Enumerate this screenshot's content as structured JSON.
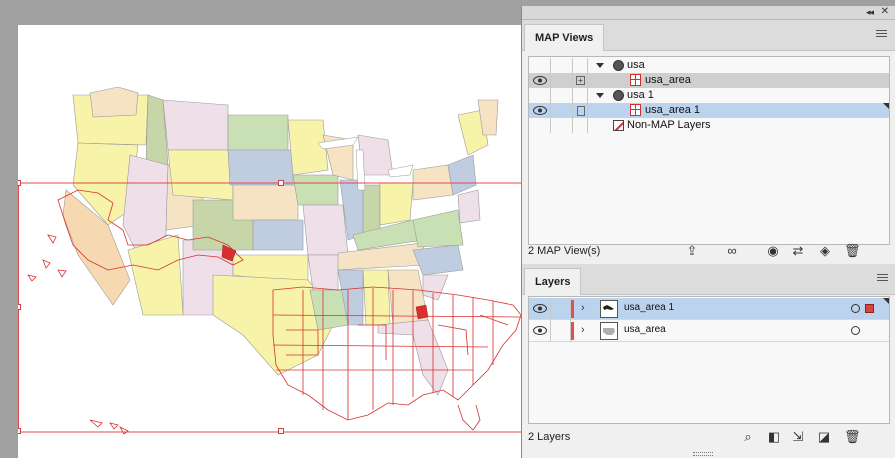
{
  "map_views_panel": {
    "tab_label": "MAP Views",
    "rows": [
      {
        "label": "usa",
        "type": "map-view"
      },
      {
        "label": "usa_area",
        "type": "map-layer"
      },
      {
        "label": "usa 1",
        "type": "map-view"
      },
      {
        "label": "usa_area 1",
        "type": "map-layer"
      },
      {
        "label": "Non-MAP Layers",
        "type": "non-map"
      }
    ],
    "footer_count": "2 MAP View(s)"
  },
  "layers_panel": {
    "tab_label": "Layers",
    "rows": [
      {
        "label": "usa_area 1"
      },
      {
        "label": "usa_area"
      }
    ],
    "footer_count": "2 Layers"
  },
  "icons": {
    "collapse": "double-chevron-icon",
    "close": "close-icon",
    "panel_menu": "hamburger-menu-icon",
    "eye": "eye-icon",
    "globe": "globe-icon",
    "grid": "area-grid-icon"
  },
  "colors": {
    "selection_blue": "#bcd3ee",
    "layer_color": "#e05050",
    "map_outline": "#d83030"
  }
}
